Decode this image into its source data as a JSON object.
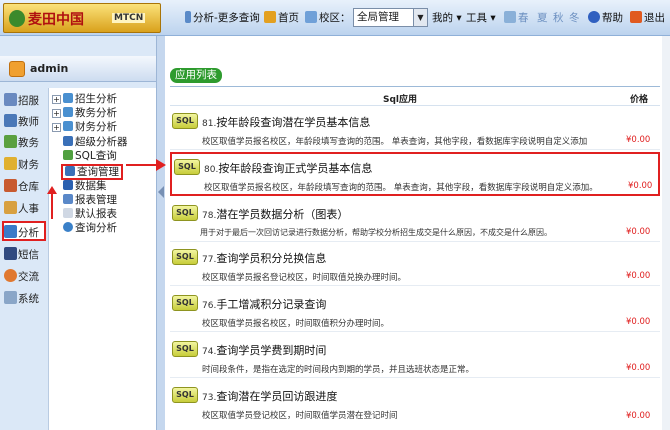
{
  "header": {
    "logo_text": "麦田中国",
    "logo_en": "MTCN",
    "tab_title": "分析-更多查询",
    "home_label": "首页",
    "campus_label": "校区：",
    "campus_value": "全局管理",
    "my_label": "我的",
    "tools_label": "工具",
    "season_spring": "春",
    "season_summer": "夏",
    "season_autumn": "秋",
    "season_winter": "冬",
    "help_label": "帮助",
    "exit_label": "退出",
    "colors": {
      "accent": "#e02020",
      "green": "#2e9b2e"
    }
  },
  "user": {
    "name": "admin"
  },
  "categories": [
    {
      "label": "招服"
    },
    {
      "label": "教师"
    },
    {
      "label": "教务"
    },
    {
      "label": "财务"
    },
    {
      "label": "仓库"
    },
    {
      "label": "人事"
    },
    {
      "label": "分析"
    },
    {
      "label": "短信"
    },
    {
      "label": "交流"
    },
    {
      "label": "系统"
    }
  ],
  "tree": [
    {
      "label": "招生分析"
    },
    {
      "label": "教务分析"
    },
    {
      "label": "财务分析"
    },
    {
      "label": "超级分析器"
    },
    {
      "label": "SQL查询"
    },
    {
      "label": "查询管理"
    },
    {
      "label": "数据集"
    },
    {
      "label": "报表管理"
    },
    {
      "label": "默认报表"
    },
    {
      "label": "查询分析"
    }
  ],
  "main": {
    "list_title": "应用列表",
    "col_sql": "Sql应用",
    "col_price": "价格",
    "badge_label": "SQL",
    "rows": [
      {
        "num": "81.",
        "title": "按年龄段查询潜在学员基本信息",
        "desc": "校区取值学员报名校区，年龄段填写查询的范围。  单表查询，其他字段，看数据库字段说明自定义添加",
        "price": "¥0.00"
      },
      {
        "num": "80.",
        "title": "按年龄段查询正式学员基本信息",
        "desc": "校区取值学员报名校区，年龄段填写查询的范围。  单表查询，其他字段，看数据库字段说明自定义添加。",
        "price": "¥0.00"
      },
      {
        "num": "78.",
        "title": "潜在学员数据分析（图表）",
        "desc": "用于对于最后一次回访记录进行数据分析，帮助学校分析招生成交是什么原因，不成交是什么原因。",
        "price": "¥0.00"
      },
      {
        "num": "77.",
        "title": "查询学员积分兑换信息",
        "desc": "校区取值学员报名登记校区，时间取值兑换办理时间。",
        "price": "¥0.00"
      },
      {
        "num": "76.",
        "title": "手工增减积分记录查询",
        "desc": "校区取值学员报名校区，时间取值积分办理时间。",
        "price": "¥0.00"
      },
      {
        "num": "74.",
        "title": "查询学员学费到期时间",
        "desc": "时间段条件，是指在选定的时间段内到期的学员，并且选班状态是正常。",
        "price": "¥0.00"
      },
      {
        "num": "73.",
        "title": "查询潜在学员回访跟进度",
        "desc": "校区取值学员登记校区，时间取值学员潜在登记时间",
        "price": "¥0.00"
      }
    ]
  }
}
